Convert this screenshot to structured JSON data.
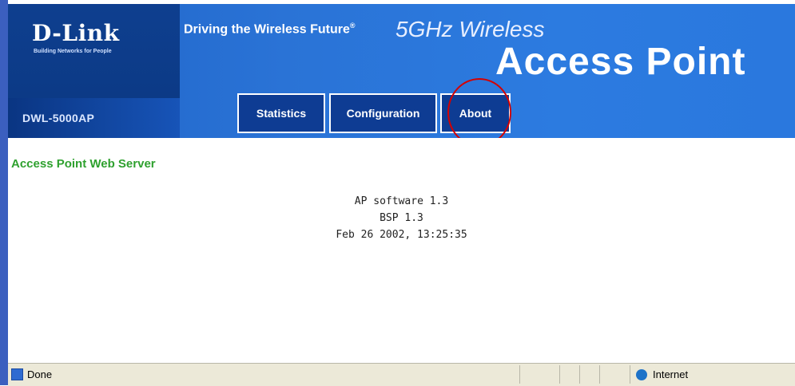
{
  "header": {
    "brand": "D-Link",
    "brand_tagline": "Building Networks for People",
    "tagline": "Driving the Wireless Future",
    "tagline_mark": "®",
    "product_line": "5GHz Wireless",
    "product_name": "Access Point",
    "model": "DWL-5000AP"
  },
  "tabs": [
    {
      "label": "Statistics"
    },
    {
      "label": "Configuration"
    },
    {
      "label": "About"
    }
  ],
  "content": {
    "title": "Access Point Web Server",
    "software_version": "AP software 1.3",
    "bsp_version": "BSP 1.3",
    "build_date": "Feb 26 2002, 13:25:35"
  },
  "statusbar": {
    "status": "Done",
    "zone": "Internet"
  },
  "colors": {
    "header_blue": "#2a73d6",
    "tab_blue": "#0e3c93",
    "title_green": "#2fa12f",
    "highlight_red": "#d40000"
  }
}
